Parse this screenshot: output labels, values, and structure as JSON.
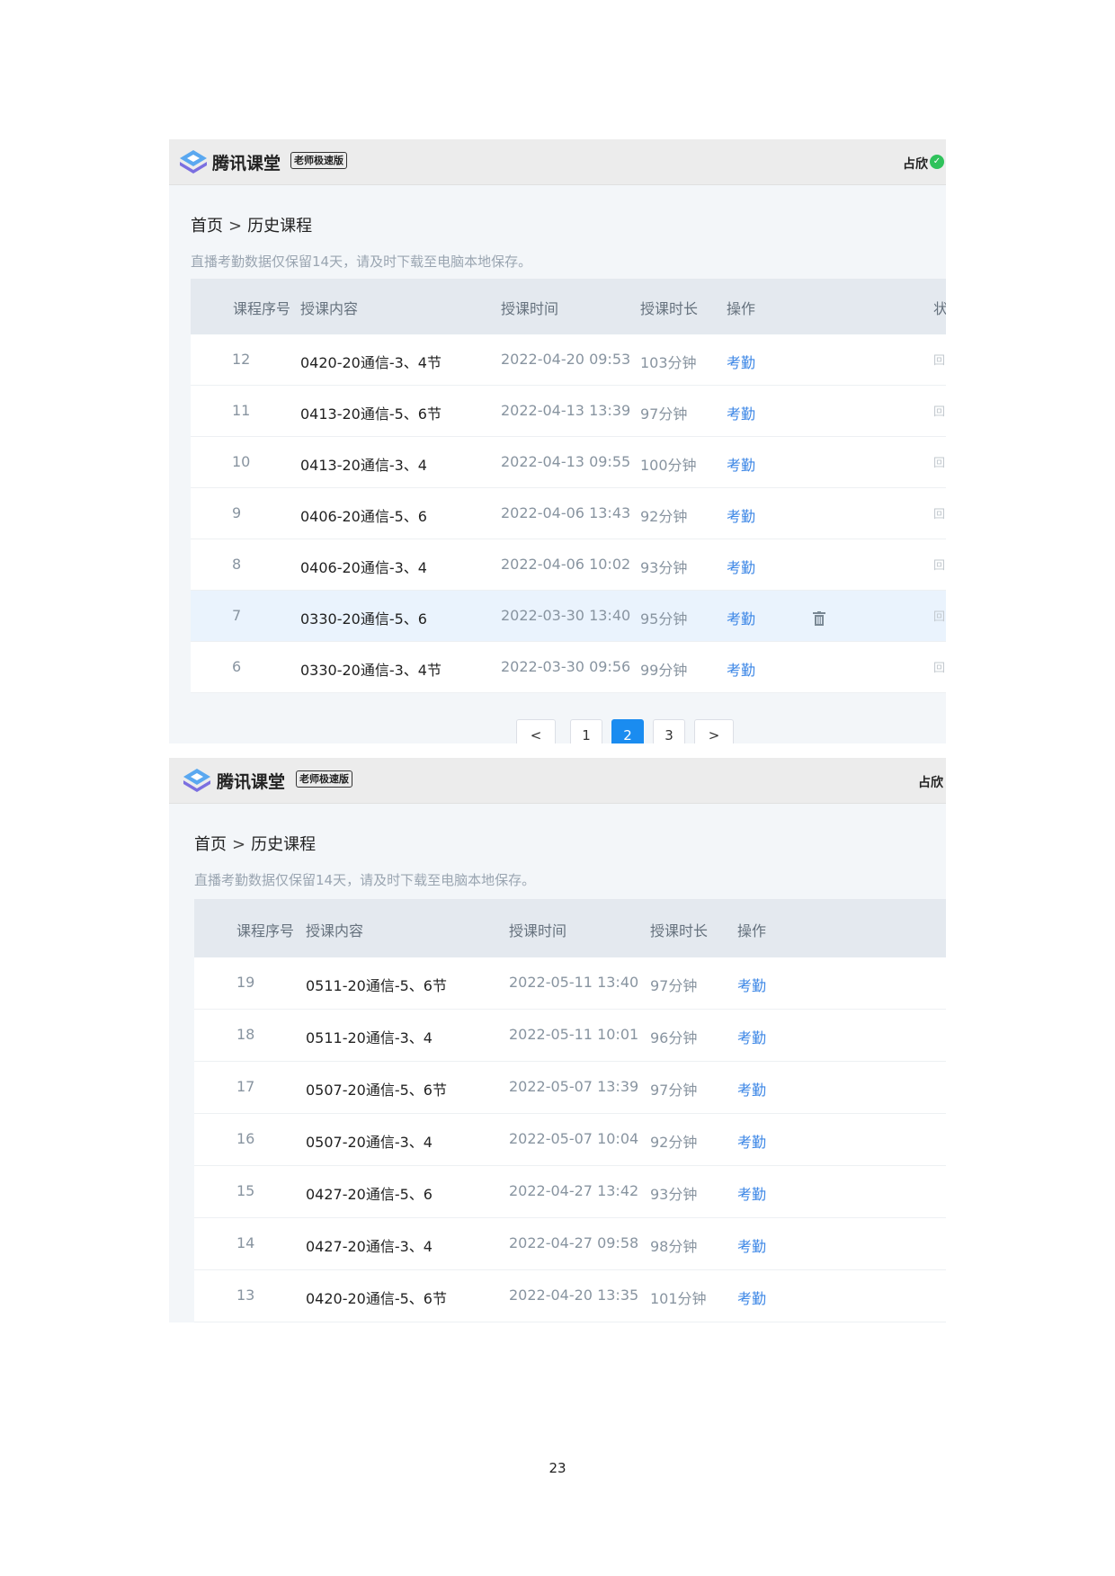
{
  "screens": [
    {
      "app": {
        "brand": "腾讯课堂",
        "edition": "老师极速版",
        "user": "占欣"
      },
      "breadcrumb": {
        "home": "首页",
        "separator": ">",
        "current": "历史课程"
      },
      "notice": "直播考勤数据仅保留14天，请及时下载至电脑本地保存。",
      "columns": {
        "id": "课程序号",
        "title": "授课内容",
        "time": "授课时间",
        "duration": "授课时长",
        "action": "操作",
        "extra": "状"
      },
      "rows": [
        {
          "id": "12",
          "title": "0420-20通信-3、4节",
          "time": "2022-04-20 09:53",
          "duration": "103分钟",
          "action": "考勤",
          "extra": "回"
        },
        {
          "id": "11",
          "title": "0413-20通信-5、6节",
          "time": "2022-04-13 13:39",
          "duration": "97分钟",
          "action": "考勤",
          "extra": "回"
        },
        {
          "id": "10",
          "title": "0413-20通信-3、4",
          "time": "2022-04-13 09:55",
          "duration": "100分钟",
          "action": "考勤",
          "extra": "回"
        },
        {
          "id": "9",
          "title": "0406-20通信-5、6",
          "time": "2022-04-06 13:43",
          "duration": "92分钟",
          "action": "考勤",
          "extra": "回"
        },
        {
          "id": "8",
          "title": "0406-20通信-3、4",
          "time": "2022-04-06 10:02",
          "duration": "93分钟",
          "action": "考勤",
          "extra": "回"
        },
        {
          "id": "7",
          "title": "0330-20通信-5、6",
          "time": "2022-03-30 13:40",
          "duration": "95分钟",
          "action": "考勤",
          "extra": "回"
        },
        {
          "id": "6",
          "title": "0330-20通信-3、4节",
          "time": "2022-03-30 09:56",
          "duration": "99分钟",
          "action": "考勤",
          "extra": "回"
        }
      ],
      "pagination": {
        "prev": "<",
        "pages": [
          "1",
          "2",
          "3"
        ],
        "current": "2",
        "next": ">"
      }
    },
    {
      "app": {
        "brand": "腾讯课堂",
        "edition": "老师极速版",
        "user": "占欣"
      },
      "breadcrumb": {
        "home": "首页",
        "separator": ">",
        "current": "历史课程"
      },
      "notice": "直播考勤数据仅保留14天，请及时下载至电脑本地保存。",
      "columns": {
        "id": "课程序号",
        "title": "授课内容",
        "time": "授课时间",
        "duration": "授课时长",
        "action": "操作"
      },
      "rows": [
        {
          "id": "19",
          "title": "0511-20通信-5、6节",
          "time": "2022-05-11 13:40",
          "duration": "97分钟",
          "action": "考勤"
        },
        {
          "id": "18",
          "title": "0511-20通信-3、4",
          "time": "2022-05-11 10:01",
          "duration": "96分钟",
          "action": "考勤"
        },
        {
          "id": "17",
          "title": "0507-20通信-5、6节",
          "time": "2022-05-07 13:39",
          "duration": "97分钟",
          "action": "考勤"
        },
        {
          "id": "16",
          "title": "0507-20通信-3、4",
          "time": "2022-05-07 10:04",
          "duration": "92分钟",
          "action": "考勤"
        },
        {
          "id": "15",
          "title": "0427-20通信-5、6",
          "time": "2022-04-27 13:42",
          "duration": "93分钟",
          "action": "考勤"
        },
        {
          "id": "14",
          "title": "0427-20通信-3、4",
          "time": "2022-04-27 09:58",
          "duration": "98分钟",
          "action": "考勤"
        },
        {
          "id": "13",
          "title": "0420-20通信-5、6节",
          "time": "2022-04-20 13:35",
          "duration": "101分钟",
          "action": "考勤"
        }
      ]
    }
  ],
  "icons": {
    "logo": "tencent-classroom-logo-icon",
    "verified": "verified-check-icon",
    "delete": "trash-icon"
  },
  "colors": {
    "link": "#3b86e6",
    "active_page": "#1a8cf0",
    "verified": "#2fc25b",
    "highlight_row": "#eaf3fd"
  },
  "page_number": "23"
}
